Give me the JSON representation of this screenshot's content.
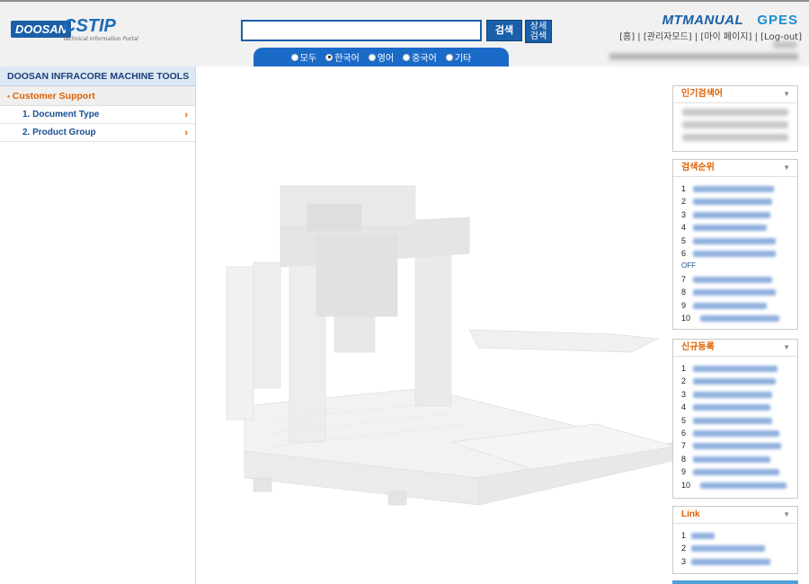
{
  "header": {
    "logo_company": "DOOSAN",
    "logo_app": "CSTIP",
    "logo_subtitle": "Technical Information Portal",
    "search_value": "",
    "search_button": "검색",
    "advanced_button": "상세\n검색",
    "languages": [
      {
        "label": "모두",
        "selected": false
      },
      {
        "label": "한국어",
        "selected": true
      },
      {
        "label": "영어",
        "selected": false
      },
      {
        "label": "중국어",
        "selected": false
      },
      {
        "label": "기타",
        "selected": false
      }
    ],
    "brand_mt": "MTMANUAL",
    "brand_gpes": "GPES",
    "links": [
      "[홈]",
      "[관리자모드]",
      "[마이 페이지]",
      "[Log-out]"
    ],
    "link_separator": "|"
  },
  "sidebar": {
    "title": "DOOSAN INFRACORE MACHINE TOOLS",
    "section": "Customer Support",
    "items": [
      {
        "label": "1. Document Type",
        "arrow": "›"
      },
      {
        "label": "2. Product Group",
        "arrow": "›"
      }
    ]
  },
  "widgets": {
    "popular": {
      "title": "인기검색어",
      "chevron": "▼"
    },
    "rank": {
      "title": "검색순위",
      "chevron": "▼",
      "numbers": [
        "1",
        "2",
        "3",
        "4",
        "5",
        "6",
        "7",
        "8",
        "9",
        "10"
      ],
      "off_label": "OFF"
    },
    "new_reg": {
      "title": "신규등록",
      "chevron": "▼",
      "numbers": [
        "1",
        "2",
        "3",
        "4",
        "5",
        "6",
        "7",
        "8",
        "9",
        "10"
      ]
    },
    "link": {
      "title": "Link",
      "chevron": "▼",
      "numbers": [
        "1",
        "2",
        "3"
      ]
    }
  },
  "colors": {
    "brand_blue": "#1a5fa8",
    "accent_orange": "#e06000",
    "nav_blue": "#1a4f94"
  }
}
